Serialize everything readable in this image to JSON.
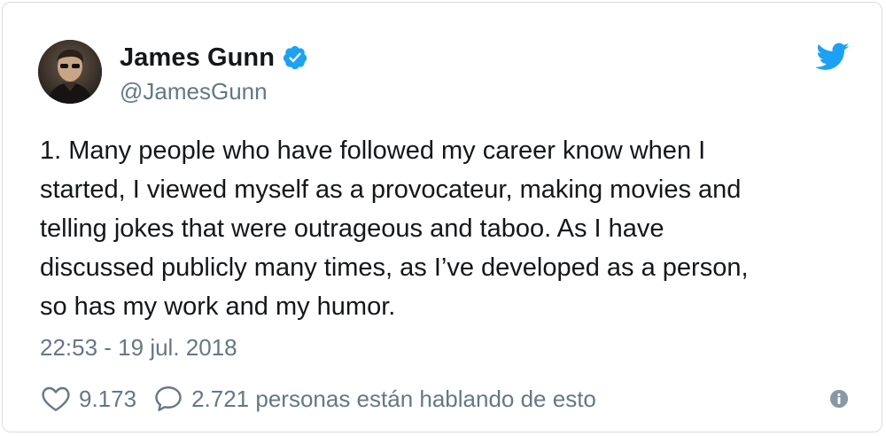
{
  "tweet": {
    "author": {
      "display_name": "James Gunn",
      "handle": "@JamesGunn",
      "verified": true,
      "avatar_icon": "profile-photo"
    },
    "text": "1. Many people who have followed my career know when I\nstarted, I viewed myself as a provocateur, making movies and\ntelling jokes that were outrageous and taboo. As I have\ndiscussed publicly many times, as I’ve developed as a person,\nso has my work and my humor.",
    "timestamp": "22:53 - 19 jul. 2018",
    "likes": "9.173",
    "conversation": "2.721 personas están hablando de esto"
  },
  "icons": {
    "brand": "twitter-bird-icon",
    "verified": "verified-badge-icon",
    "like": "heart-icon",
    "reply": "speech-bubble-icon",
    "info": "info-icon"
  },
  "colors": {
    "brand_blue": "#1da1f2",
    "text_primary": "#14171a",
    "text_secondary": "#657786",
    "border": "#d8dde1"
  }
}
